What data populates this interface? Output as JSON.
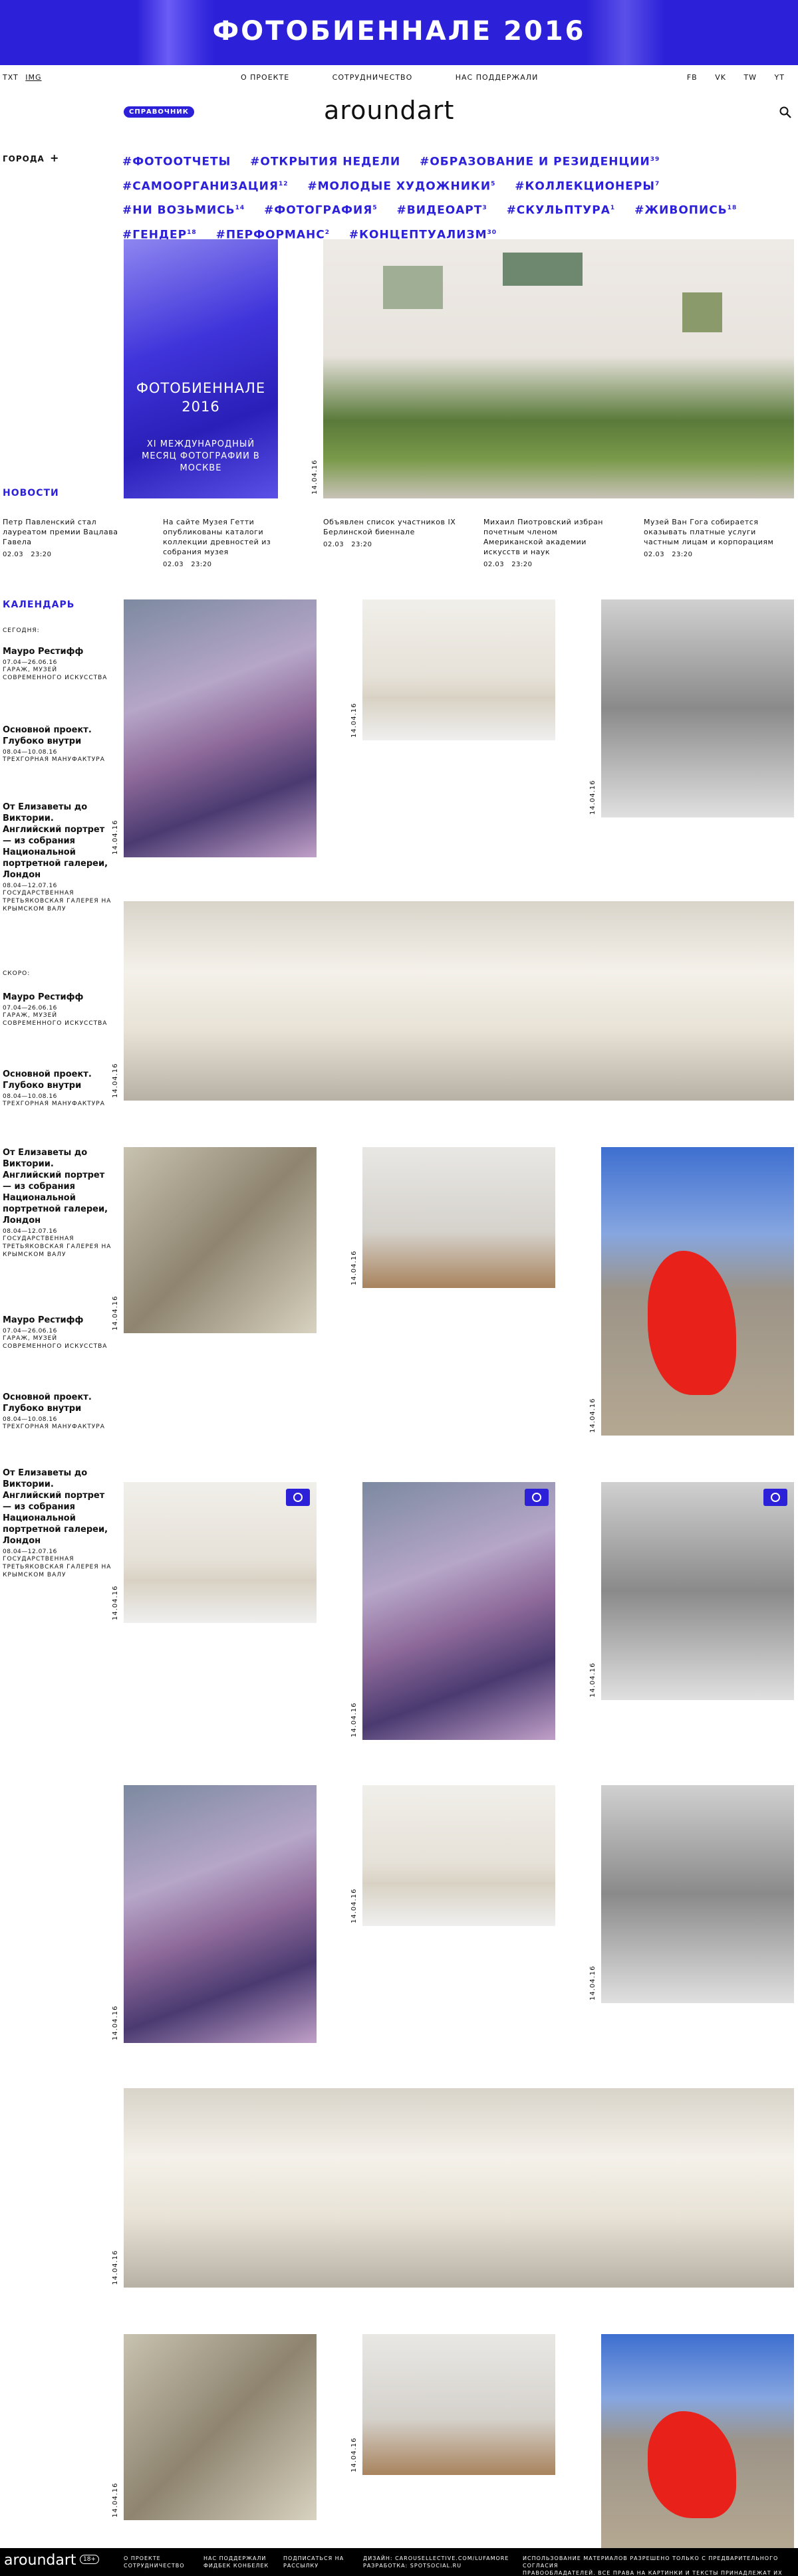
{
  "banner": {
    "title": "ФОТОБИЕННАЛЕ 2016"
  },
  "header": {
    "lang_txt": "TXT",
    "lang_img": "IMG",
    "nav": [
      "О ПРОЕКТЕ",
      "СОТРУДНИЧЕСТВО",
      "НАС ПОДДЕРЖАЛИ"
    ],
    "social": [
      "FB",
      "VK",
      "TW",
      "YT"
    ]
  },
  "sprav": "СПРАВОЧНИК",
  "logo": "aroundart",
  "cities": "ГОРОДА",
  "tags": [
    {
      "label": "#ФОТООТЧЕТЫ",
      "count": ""
    },
    {
      "label": "#ОТКРЫТИЯ НЕДЕЛИ",
      "count": ""
    },
    {
      "label": "#ОБРАЗОВАНИЕ И РЕЗИДЕНЦИИ",
      "count": "39"
    },
    {
      "label": "#САМООРГАНИЗАЦИЯ",
      "count": "12"
    },
    {
      "label": "#МОЛОДЫЕ ХУДОЖНИКИ",
      "count": "5"
    },
    {
      "label": "#КОЛЛЕКЦИОНЕРЫ",
      "count": "7"
    },
    {
      "label": "#НИ ВОЗЬМИСЬ",
      "count": "14"
    },
    {
      "label": "#ФОТОГРАФИЯ",
      "count": "5"
    },
    {
      "label": "#ВИДЕОАРТ",
      "count": "3"
    },
    {
      "label": "#СКУЛЬПТУРА",
      "count": "1"
    },
    {
      "label": "#ЖИВОПИСЬ",
      "count": "18"
    },
    {
      "label": "#ГЕНДЕР",
      "count": "18"
    },
    {
      "label": "#ПЕРФОРМАНС",
      "count": "2"
    },
    {
      "label": "#КОНЦЕПТУАЛИЗМ",
      "count": "30"
    }
  ],
  "feature": {
    "title": "ФОТОБИЕННАЛЕ 2016",
    "subtitle": "XI МЕЖДУНАРОДНЫЙ МЕСЯЦ ФОТОГРАФИИ В МОСКВЕ"
  },
  "date_label": "14.04.16",
  "news": {
    "heading": "НОВОСТИ",
    "items": [
      {
        "text": "Петр Павленский стал лауреатом премии Вацлава Гавела",
        "date": "02.03",
        "time": "23:20"
      },
      {
        "text": "На сайте Музея Гетти опубликованы каталоги коллекции древностей из собрания музея",
        "date": "02.03",
        "time": "23:20"
      },
      {
        "text": "Объявлен список участников IX Берлинской биеннале",
        "date": "02.03",
        "time": "23:20"
      },
      {
        "text": "Михаил Пиотровский избран почетным членом Американской академии искусств и наук",
        "date": "02.03",
        "time": "23:20"
      },
      {
        "text": "Музей Ван Гога собирается оказывать платные услуги частным лицам и корпорациям",
        "date": "02.03",
        "time": "23:20"
      }
    ]
  },
  "calendar": {
    "heading": "КАЛЕНДАРЬ",
    "today_label": "СЕГОДНЯ:",
    "soon_label": "СКОРО:",
    "events": [
      {
        "name": "Мауро Рестифф",
        "dates": "07.04—26.06.16",
        "place": "ГАРАЖ, МУЗЕЙ СОВРЕМЕННОГО ИСКУССТВА"
      },
      {
        "name": "Основной проект. Глубоко внутри",
        "dates": "08.04—10.08.16",
        "place": "ТРЕХГОРНАЯ МАНУФАКТУРА"
      },
      {
        "name": "От Елизаветы до Виктории. Английский портрет — из собрания Национальной портретной галереи, Лондон",
        "dates": "08.04—12.07.16",
        "place": "ГОСУДАРСТВЕННАЯ ТРЕТЬЯКОВСКАЯ ГАЛЕРЕЯ НА КРЫМСКОМ ВАЛУ"
      }
    ]
  },
  "footer": {
    "logo": "aroundart",
    "age": "18+",
    "col1": [
      "О ПРОЕКТЕ",
      "СОТРУДНИЧЕСТВО"
    ],
    "col2": [
      "НАС ПОДДЕРЖАЛИ",
      "ФИДБЕК КОНБЕЛЕК"
    ],
    "col3": [
      "ПОДПИСАТЬСЯ НА",
      "РАССЫЛКУ"
    ],
    "col4": [
      "ДИЗАЙН: CAROUSELLECTIVE.COM/LUFAMORE",
      "РАЗРАБОТКА: SPOTSOCIAL.RU"
    ],
    "col5": [
      "ИСПОЛЬЗОВАНИЕ МАТЕРИАЛОВ РАЗРЕШЕНО ТОЛЬКО С ПРЕДВАРИТЕЛЬНОГО СОГЛАСИЯ",
      "ПРАВООБЛАДАТЕЛЕЙ. ВСЕ ПРАВА НА КАРТИНКИ И ТЕКСТЫ ПРИНАДЛЕЖАТ ИХ АВТОРАМ."
    ]
  }
}
